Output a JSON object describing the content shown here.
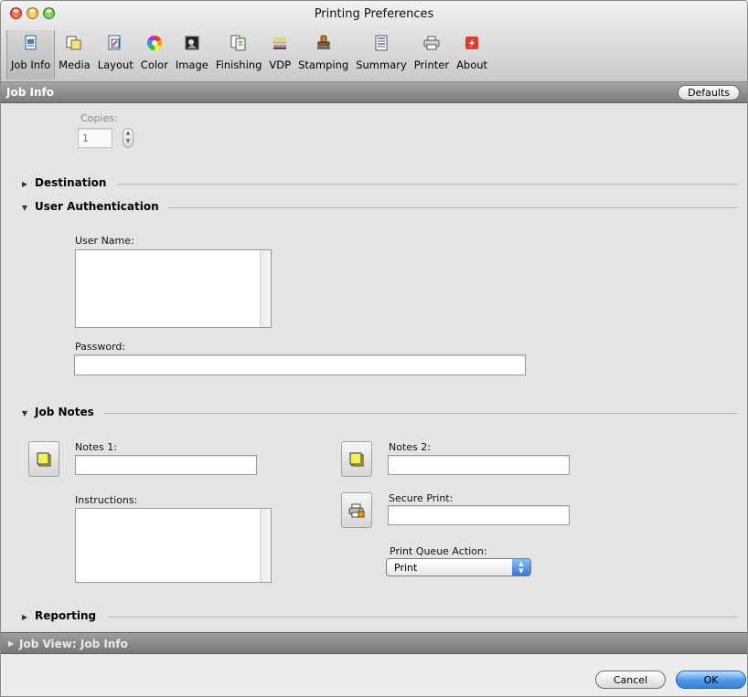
{
  "window": {
    "title": "Printing Preferences"
  },
  "toolbar": {
    "items": [
      {
        "label": "Job Info",
        "icon": "job-info-icon",
        "active": true
      },
      {
        "label": "Media",
        "icon": "media-icon"
      },
      {
        "label": "Layout",
        "icon": "layout-icon"
      },
      {
        "label": "Color",
        "icon": "color-wheel-icon"
      },
      {
        "label": "Image",
        "icon": "image-icon"
      },
      {
        "label": "Finishing",
        "icon": "finishing-icon"
      },
      {
        "label": "VDP",
        "icon": "vdp-icon"
      },
      {
        "label": "Stamping",
        "icon": "stamp-icon"
      },
      {
        "label": "Summary",
        "icon": "summary-icon"
      },
      {
        "label": "Printer",
        "icon": "printer-icon"
      },
      {
        "label": "About",
        "icon": "about-icon"
      }
    ]
  },
  "section": {
    "title": "Job Info",
    "defaults_label": "Defaults"
  },
  "copies": {
    "label": "Copies:",
    "value": "1"
  },
  "sections": {
    "destination": "Destination",
    "user_auth": "User Authentication",
    "job_notes": "Job Notes",
    "reporting": "Reporting"
  },
  "user_auth": {
    "username_label": "User Name:",
    "username_value": "",
    "password_label": "Password:",
    "password_value": ""
  },
  "job_notes": {
    "notes1_label": "Notes 1:",
    "notes1_value": "",
    "notes2_label": "Notes 2:",
    "notes2_value": "",
    "instructions_label": "Instructions:",
    "instructions_value": "",
    "secure_print_label": "Secure Print:",
    "secure_print_value": "",
    "pqa_label": "Print Queue Action:",
    "pqa_value": "Print"
  },
  "job_view": {
    "title": "Job View: Job Info"
  },
  "footer": {
    "cancel_label": "Cancel",
    "ok_label": "OK"
  },
  "colors": {
    "accent": "#3a82d8",
    "note_yellow": "#f3e31a",
    "about_red": "#e23b2a"
  }
}
